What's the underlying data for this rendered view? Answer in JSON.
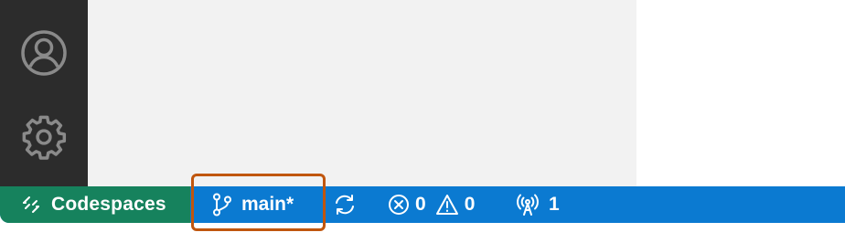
{
  "activity_bar": {
    "items": [
      {
        "icon": "accounts-icon"
      },
      {
        "icon": "gear-icon"
      }
    ]
  },
  "status_bar": {
    "remote": {
      "label": "Codespaces",
      "icon": "remote-icon",
      "color": "#16825d"
    },
    "branch": {
      "label": "main*",
      "icon": "git-branch-icon"
    },
    "sync": {
      "icon": "sync-icon"
    },
    "problems": {
      "errors": "0",
      "warnings": "0"
    },
    "ports": {
      "count": "1",
      "icon": "radio-tower-icon"
    },
    "color": "#0b7ad1"
  },
  "highlight": {
    "color": "#c0560e",
    "target": "branch"
  }
}
